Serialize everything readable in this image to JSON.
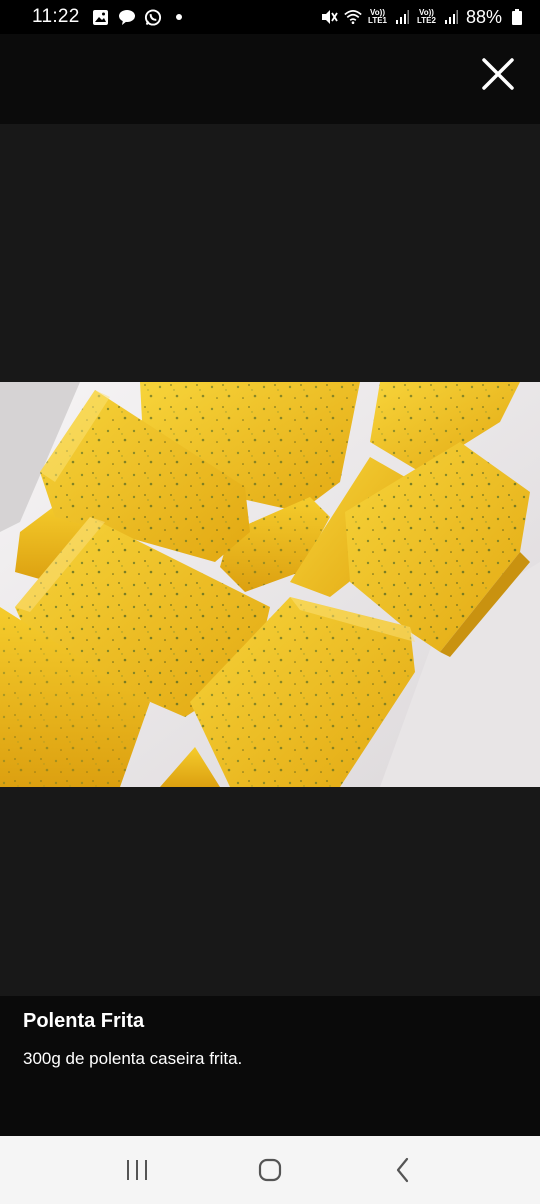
{
  "status_bar": {
    "time": "11:22",
    "notifications": [
      "gallery-icon",
      "chat-bubble-icon",
      "whatsapp-icon",
      "dot-icon"
    ],
    "sim1_label_top": "Vo))",
    "sim1_label_bottom": "LTE1",
    "sim2_label_top": "Vo))",
    "sim2_label_bottom": "LTE2",
    "battery": "88%"
  },
  "top_bar": {
    "close_icon": "close-icon"
  },
  "viewer": {
    "image_subject": "fried polenta sticks with herbs",
    "colors": {
      "background": "#181818",
      "polenta": "#f2c21c",
      "plate": "#ece9ea"
    }
  },
  "caption": {
    "title": "Polenta Frita",
    "description": "300g de polenta caseira frita."
  },
  "nav_bar": {
    "buttons": [
      "recents-icon",
      "home-icon",
      "back-icon"
    ]
  }
}
